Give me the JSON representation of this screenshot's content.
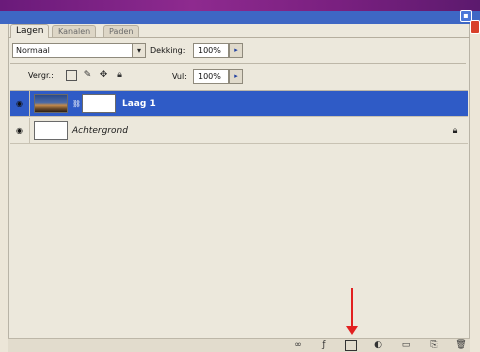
{
  "tabs": [
    {
      "label": "Lagen",
      "active": true
    },
    {
      "label": "Kanalen",
      "active": false
    },
    {
      "label": "Paden",
      "active": false
    }
  ],
  "options": {
    "blend_mode": "Normaal",
    "opacity_label": "Dekking:",
    "opacity_value": "100%",
    "lock_label": "Vergr.:",
    "fill_label": "Vul:",
    "fill_value": "100%"
  },
  "layers": [
    {
      "name": "Laag 1",
      "selected": true,
      "visible": true,
      "has_mask": true,
      "locked": false
    },
    {
      "name": "Achtergrond",
      "selected": false,
      "visible": true,
      "has_mask": false,
      "locked": true
    }
  ],
  "icons": {
    "eye": "eye-icon",
    "lock": "lock-icon",
    "link": "link-icon",
    "style": "layer-style-icon",
    "mask": "add-mask-icon",
    "adjustment": "adjustment-layer-icon",
    "folder": "new-group-icon",
    "new_layer": "new-layer-icon",
    "trash": "delete-layer-icon"
  },
  "colors": {
    "selection": "#2f5bc6",
    "annotation_arrow": "#e22020",
    "panel_bg": "#ece8dc"
  }
}
